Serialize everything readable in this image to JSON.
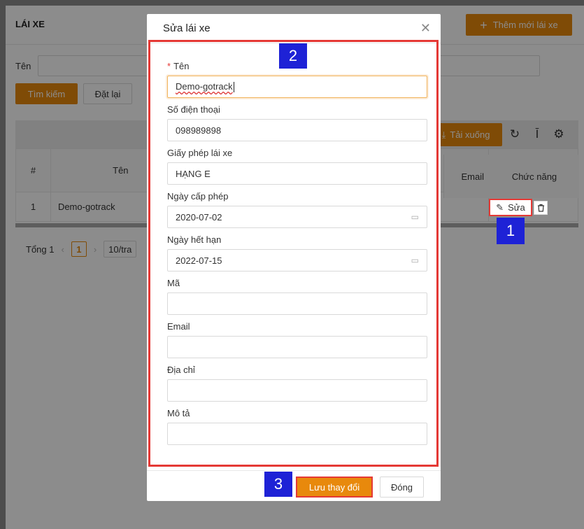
{
  "page": {
    "title": "LÁI XE",
    "add_button": "Thêm mới lái xe",
    "search_label": "Tên",
    "search_button": "Tìm kiếm",
    "reset_button": "Đặt lại",
    "download_button": "Tải xuống",
    "table": {
      "headers": [
        "#",
        "Tên",
        "Email",
        "Chức năng"
      ],
      "rows": [
        {
          "index": "1",
          "name": "Demo-gotrack"
        }
      ]
    },
    "edit_button": "Sửa",
    "pager": {
      "total": "Tổng 1",
      "current": "1",
      "page_size": "10/tra"
    }
  },
  "modal": {
    "title": "Sửa lái xe",
    "fields": {
      "name": {
        "label": "Tên",
        "value": "Demo-gotrack"
      },
      "phone": {
        "label": "Số điện thoại",
        "value": "098989898"
      },
      "license": {
        "label": "Giấy phép lái xe",
        "value": "HẠNG E"
      },
      "issue_date": {
        "label": "Ngày cấp phép",
        "value": "2020-07-02"
      },
      "expiry_date": {
        "label": "Ngày hết hạn",
        "value": "2022-07-15"
      },
      "code": {
        "label": "Mã",
        "value": ""
      },
      "email": {
        "label": "Email",
        "value": ""
      },
      "address": {
        "label": "Địa chỉ",
        "value": ""
      },
      "description": {
        "label": "Mô tả",
        "value": ""
      }
    },
    "save_button": "Lưu thay đổi",
    "close_button": "Đóng"
  },
  "markers": {
    "m1": "1",
    "m2": "2",
    "m3": "3"
  },
  "colors": {
    "accent": "#e8890c",
    "highlight": "#e53935",
    "marker": "#1e22d6"
  }
}
